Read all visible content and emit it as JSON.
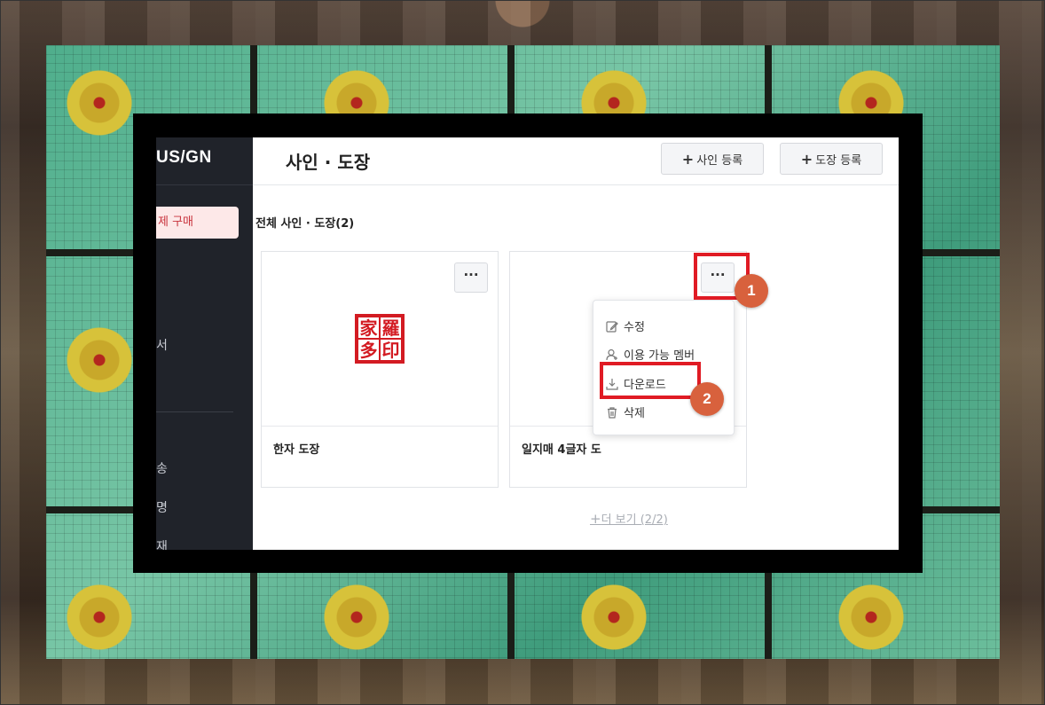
{
  "sidebar": {
    "brand": "US/GN",
    "active_item": "제 구매",
    "items": [
      "서",
      "송",
      "명",
      "재"
    ]
  },
  "header": {
    "title": "사인 · 도장",
    "add_sign": "사인 등록",
    "add_stamp": "도장 등록"
  },
  "section_title": "전체 사인 · 도장(2)",
  "cards": [
    {
      "name": "한자 도장",
      "seal_chars": [
        "家",
        "羅",
        "多",
        "印"
      ]
    },
    {
      "name": "일지매 4글자 도"
    }
  ],
  "more_label": "···",
  "menu": {
    "items": [
      {
        "label": "수정",
        "icon": "edit-icon"
      },
      {
        "label": "이용 가능 멤버",
        "icon": "user-plus-icon"
      },
      {
        "label": "다운로드",
        "icon": "download-icon"
      },
      {
        "label": "삭제",
        "icon": "trash-icon"
      }
    ]
  },
  "load_more": "더 보기 (2/2)",
  "markers": [
    "1",
    "2"
  ],
  "colors": {
    "highlight": "#e01b24",
    "marker": "#d8613d",
    "active_text": "#c8323c",
    "sidebar_bg": "#20232a"
  }
}
